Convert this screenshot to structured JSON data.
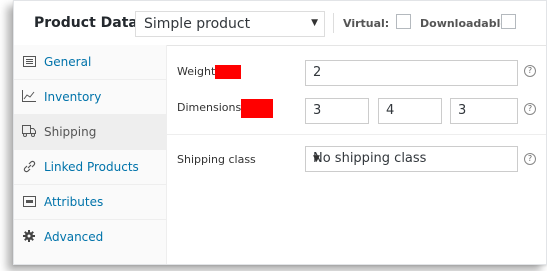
{
  "header": {
    "title": "Product Data —",
    "product_type": "Simple product",
    "virtual_label": "Virtual:",
    "downloadable_label": "Downloadable:"
  },
  "sidebar": {
    "items": [
      {
        "label": "General",
        "icon": "general-icon"
      },
      {
        "label": "Inventory",
        "icon": "inventory-icon"
      },
      {
        "label": "Shipping",
        "icon": "shipping-icon",
        "active": true
      },
      {
        "label": "Linked Products",
        "icon": "link-icon"
      },
      {
        "label": "Attributes",
        "icon": "attributes-icon"
      },
      {
        "label": "Advanced",
        "icon": "gear-icon"
      }
    ]
  },
  "shipping": {
    "weight_label": "Weight",
    "weight_value": "2",
    "dimensions_label": "Dimensions",
    "length": "3",
    "width": "4",
    "height": "3",
    "class_label": "Shipping class",
    "class_value": "No shipping class"
  },
  "colors": {
    "link": "#0073aa",
    "redaction": "#ff0000",
    "active_tab": "#eeeeee"
  }
}
